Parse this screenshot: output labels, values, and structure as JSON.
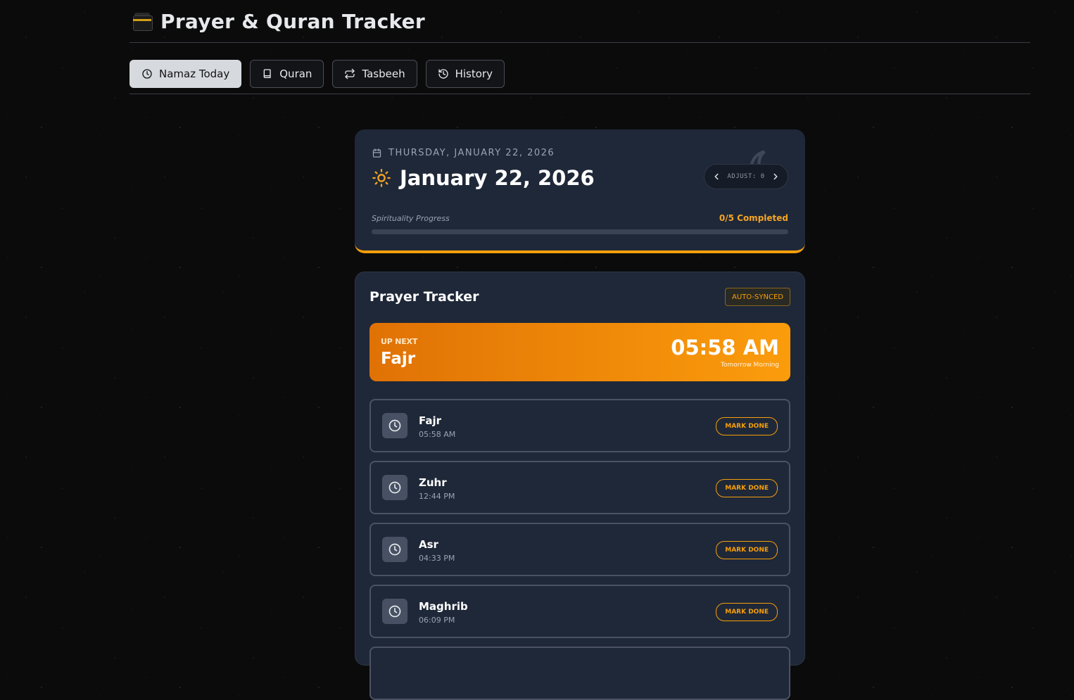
{
  "header": {
    "title": "Prayer & Quran Tracker",
    "logo_icon": "kaaba-icon"
  },
  "tabs": [
    {
      "label": "Namaz Today",
      "icon": "clock-icon",
      "active": true
    },
    {
      "label": "Quran",
      "icon": "book-icon",
      "active": false
    },
    {
      "label": "Tasbeeh",
      "icon": "repeat-icon",
      "active": false
    },
    {
      "label": "History",
      "icon": "history-icon",
      "active": false
    }
  ],
  "date_card": {
    "weekday_line": "THURSDAY, JANUARY 22, 2026",
    "date_title": "January 22, 2026",
    "adjust_label": "ADJUST: 0",
    "progress_label": "Spirituality Progress",
    "progress_status": "0/5 Completed",
    "progress_fraction": 0
  },
  "tracker": {
    "title": "Prayer Tracker",
    "badge": "AUTO-SYNCED",
    "next": {
      "label": "UP NEXT",
      "name": "Fajr",
      "time": "05:58 AM",
      "note": "Tomorrow Morning"
    },
    "prayers": [
      {
        "name": "Fajr",
        "time": "05:58 AM",
        "action": "MARK DONE"
      },
      {
        "name": "Zuhr",
        "time": "12:44 PM",
        "action": "MARK DONE"
      },
      {
        "name": "Asr",
        "time": "04:33 PM",
        "action": "MARK DONE"
      },
      {
        "name": "Maghrib",
        "time": "06:09 PM",
        "action": "MARK DONE"
      }
    ]
  },
  "colors": {
    "accent": "#f59e0b",
    "card_bg": "#1f2838",
    "page_bg": "#0b0b0c"
  }
}
